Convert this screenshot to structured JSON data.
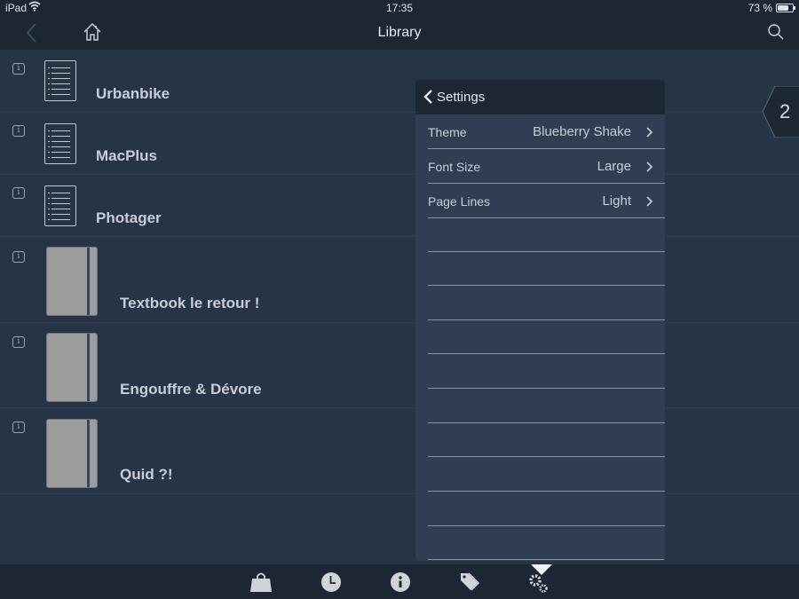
{
  "status": {
    "device": "iPad",
    "time": "17:35",
    "battery": "73 %",
    "battery_level": 0.73
  },
  "nav": {
    "title": "Library"
  },
  "library": {
    "items": [
      {
        "title": "Urbanbike",
        "kind": "document"
      },
      {
        "title": "MacPlus",
        "kind": "document"
      },
      {
        "title": "Photager",
        "kind": "document"
      },
      {
        "title": "Textbook le retour !",
        "kind": "book"
      },
      {
        "title": "Engouffre & Dévore",
        "kind": "book"
      },
      {
        "title": "Quid ?!",
        "kind": "book"
      }
    ]
  },
  "settings": {
    "title": "Settings",
    "rows": [
      {
        "label": "Theme",
        "value": "Blueberry Shake"
      },
      {
        "label": "Font Size",
        "value": "Large"
      },
      {
        "label": "Page Lines",
        "value": "Light"
      }
    ]
  },
  "page_tab": {
    "number": "2"
  },
  "tabbar": {
    "items": [
      {
        "icon": "shopping-bag-icon"
      },
      {
        "icon": "clock-icon"
      },
      {
        "icon": "info-icon"
      },
      {
        "icon": "tags-icon"
      },
      {
        "icon": "gears-icon",
        "selected": true
      }
    ]
  },
  "colors": {
    "background": "#263446",
    "bar": "#1d2733",
    "popover": "#2f3e52",
    "text": "#c9ced6"
  }
}
